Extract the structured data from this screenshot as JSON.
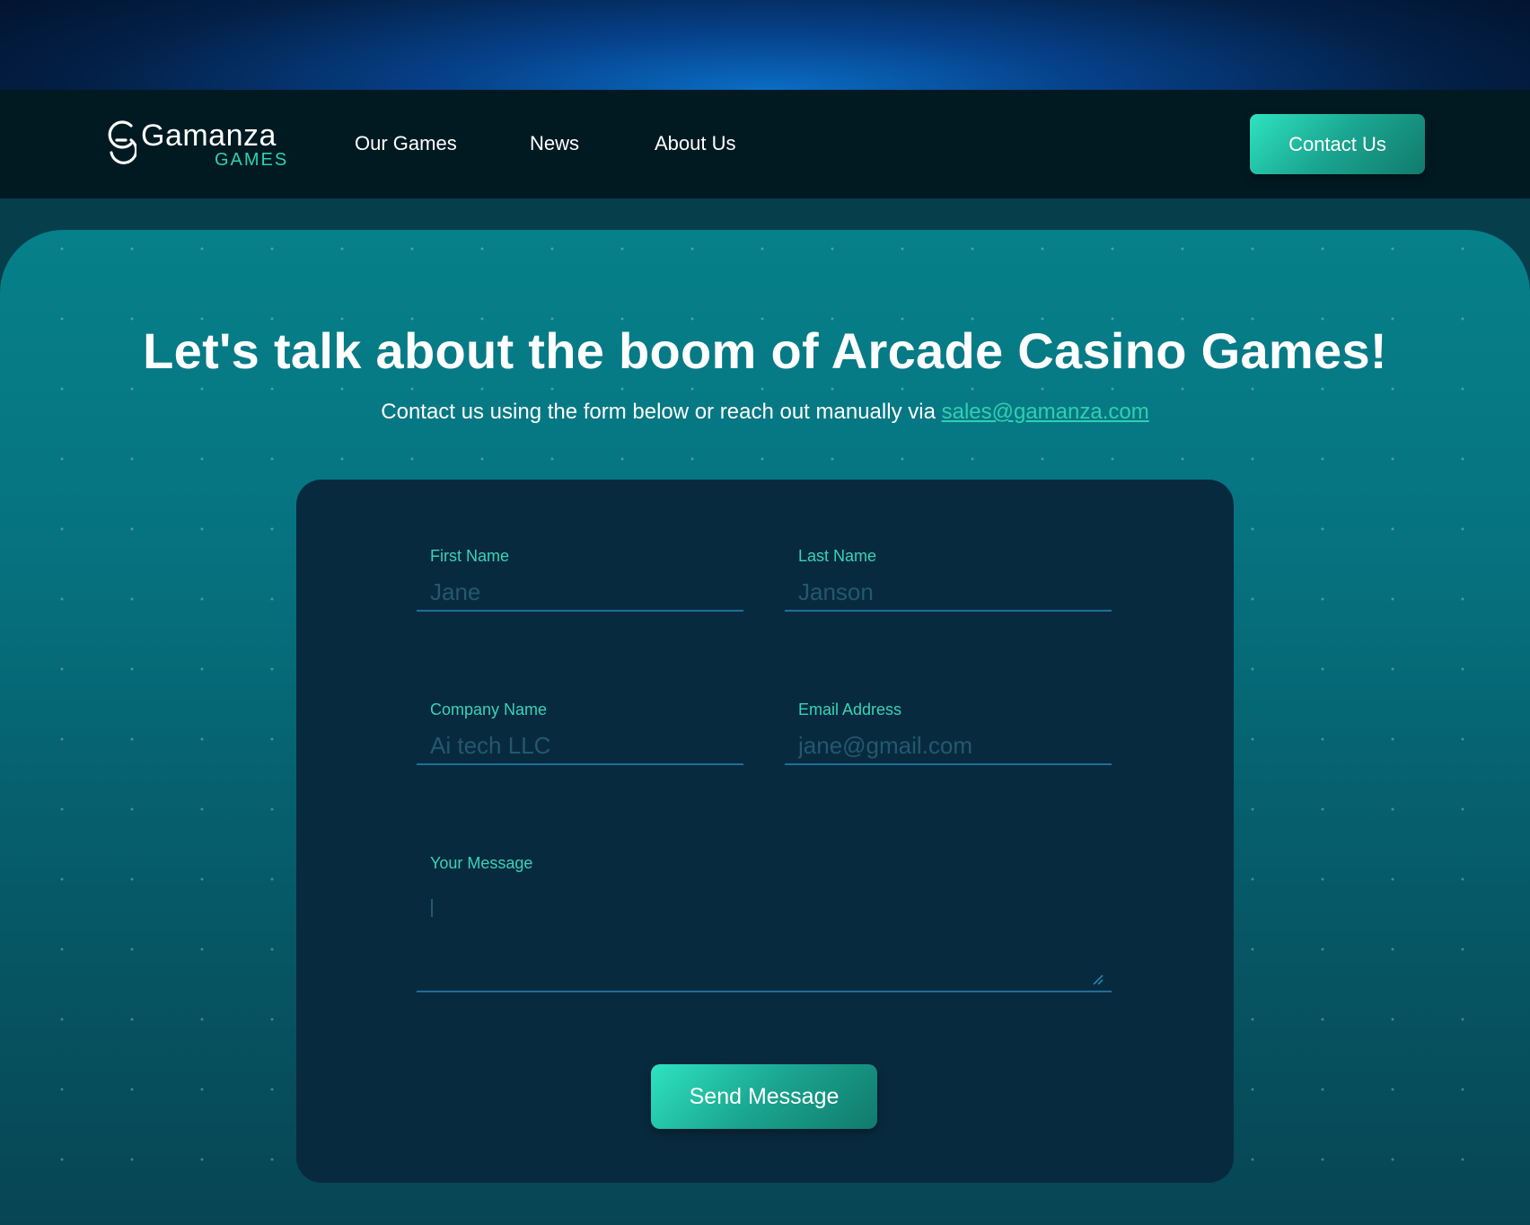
{
  "logo": {
    "word": "Gamanza",
    "sub": "GAMES"
  },
  "nav": {
    "links": [
      "Our Games",
      "News",
      "About Us"
    ],
    "contact_label": "Contact Us"
  },
  "hero": {
    "headline": "Let's talk about the boom of Arcade Casino Games!",
    "subline_text": "Contact us using the form below or reach out manually via ",
    "email_link": "sales@gamanza.com"
  },
  "form": {
    "first_name": {
      "label": "First Name",
      "placeholder": "Jane"
    },
    "last_name": {
      "label": "Last Name",
      "placeholder": "Janson"
    },
    "company": {
      "label": "Company Name",
      "placeholder": "Ai tech LLC"
    },
    "email": {
      "label": "Email Address",
      "placeholder": "jane@gmail.com"
    },
    "message": {
      "label": "Your Message"
    },
    "submit_label": "Send Message"
  },
  "colors": {
    "accent": "#2fd0b0",
    "nav_bg": "#011a22",
    "card_bg": "#082a3f",
    "hero_bg": "#067480"
  }
}
